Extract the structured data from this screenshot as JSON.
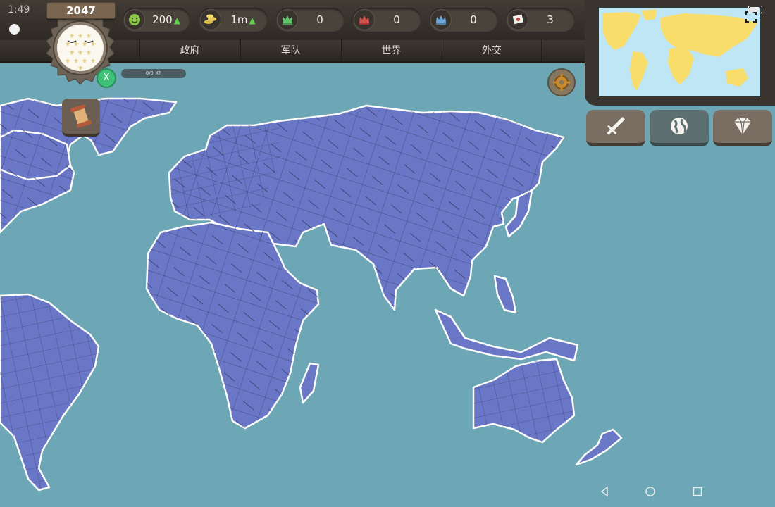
{
  "status_bar": {
    "time": "1:49",
    "battery_icon": "battery-icon"
  },
  "year": "2047",
  "player": {
    "emblem_icon": "fleur-de-lis-flag-icon",
    "badge_label": "X",
    "xp_label": "0/0 XP"
  },
  "resources": [
    {
      "name": "happiness",
      "icon": "smiley-icon",
      "value": "200",
      "trend": "up"
    },
    {
      "name": "money",
      "icon": "coins-icon",
      "value": "1m",
      "trend": "up"
    },
    {
      "name": "green-crown",
      "icon": "green-crown-icon",
      "value": "0"
    },
    {
      "name": "red-crown",
      "icon": "red-crown-icon",
      "value": "0"
    },
    {
      "name": "blue-crown",
      "icon": "blue-crown-icon",
      "value": "0"
    },
    {
      "name": "flags",
      "icon": "flag-icon",
      "value": "3"
    }
  ],
  "tabs": [
    {
      "label": "政府"
    },
    {
      "label": "军队"
    },
    {
      "label": "世界"
    },
    {
      "label": "外交"
    }
  ],
  "action_buttons": [
    {
      "icon": "sword-icon"
    },
    {
      "icon": "globe-icon"
    },
    {
      "icon": "diamond-icon"
    }
  ],
  "colors": {
    "ocean": "#6da6b4",
    "land": "#6a77c7",
    "border": "#1f2340",
    "coast": "#ffffff",
    "minimap_land": "#f8dd6b",
    "minimap_sea": "#bfe6f4",
    "wood": "#3d3731",
    "badge_green": "#3fc17a"
  }
}
